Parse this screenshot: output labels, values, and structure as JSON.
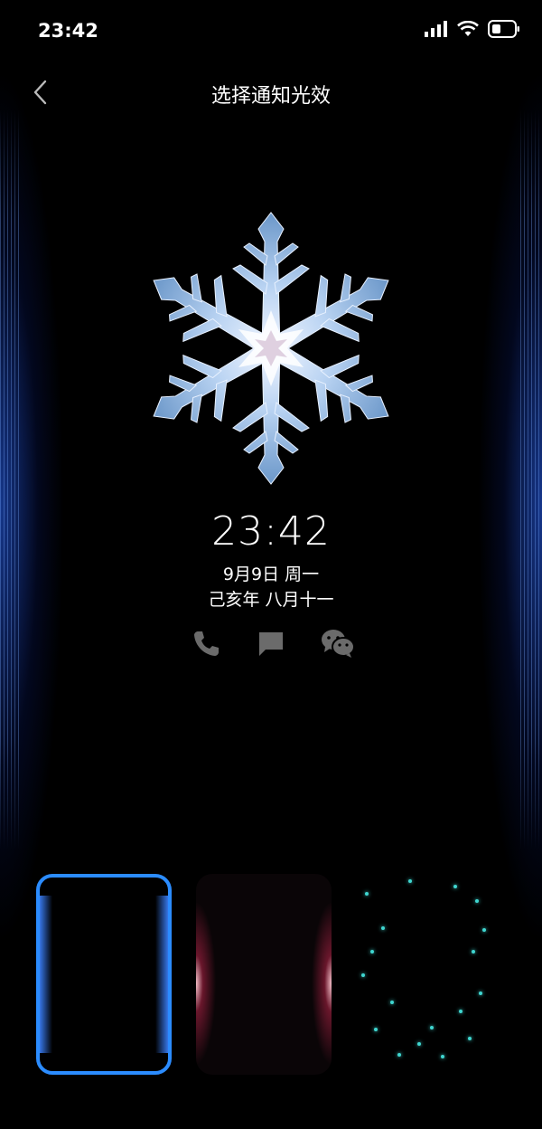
{
  "status_bar": {
    "time": "23:42",
    "icons": [
      "signal-icon",
      "wifi-icon",
      "battery-icon"
    ]
  },
  "nav": {
    "title": "选择通知光效",
    "back_icon": "chevron-left-icon"
  },
  "lock_preview": {
    "clock": "23:42",
    "date": "9月9日 周一",
    "lunar_date": "己亥年 八月十一",
    "notification_icons": [
      "phone-icon",
      "message-icon",
      "wechat-icon"
    ]
  },
  "effects": {
    "selected_index": 0,
    "options": [
      "blue-edge-glow",
      "red-edge-glow",
      "cyan-particles"
    ]
  },
  "colors": {
    "background": "#000000",
    "accent": "#2b8cff",
    "edge_glow": "#2864ff",
    "particle": "#3fd6d0"
  }
}
